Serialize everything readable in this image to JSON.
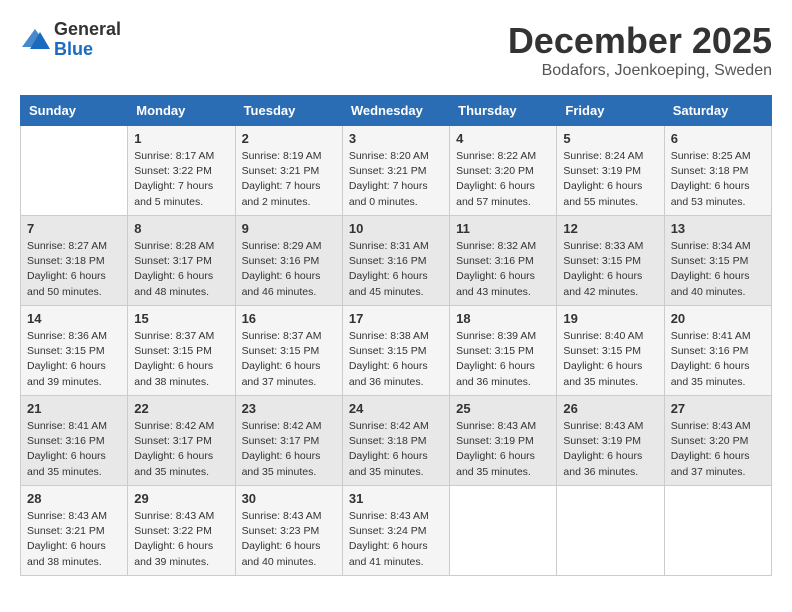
{
  "logo": {
    "general": "General",
    "blue": "Blue"
  },
  "title": "December 2025",
  "location": "Bodafors, Joenkoeping, Sweden",
  "days_header": [
    "Sunday",
    "Monday",
    "Tuesday",
    "Wednesday",
    "Thursday",
    "Friday",
    "Saturday"
  ],
  "weeks": [
    [
      {
        "day": "",
        "info": ""
      },
      {
        "day": "1",
        "info": "Sunrise: 8:17 AM\nSunset: 3:22 PM\nDaylight: 7 hours\nand 5 minutes."
      },
      {
        "day": "2",
        "info": "Sunrise: 8:19 AM\nSunset: 3:21 PM\nDaylight: 7 hours\nand 2 minutes."
      },
      {
        "day": "3",
        "info": "Sunrise: 8:20 AM\nSunset: 3:21 PM\nDaylight: 7 hours\nand 0 minutes."
      },
      {
        "day": "4",
        "info": "Sunrise: 8:22 AM\nSunset: 3:20 PM\nDaylight: 6 hours\nand 57 minutes."
      },
      {
        "day": "5",
        "info": "Sunrise: 8:24 AM\nSunset: 3:19 PM\nDaylight: 6 hours\nand 55 minutes."
      },
      {
        "day": "6",
        "info": "Sunrise: 8:25 AM\nSunset: 3:18 PM\nDaylight: 6 hours\nand 53 minutes."
      }
    ],
    [
      {
        "day": "7",
        "info": "Sunrise: 8:27 AM\nSunset: 3:18 PM\nDaylight: 6 hours\nand 50 minutes."
      },
      {
        "day": "8",
        "info": "Sunrise: 8:28 AM\nSunset: 3:17 PM\nDaylight: 6 hours\nand 48 minutes."
      },
      {
        "day": "9",
        "info": "Sunrise: 8:29 AM\nSunset: 3:16 PM\nDaylight: 6 hours\nand 46 minutes."
      },
      {
        "day": "10",
        "info": "Sunrise: 8:31 AM\nSunset: 3:16 PM\nDaylight: 6 hours\nand 45 minutes."
      },
      {
        "day": "11",
        "info": "Sunrise: 8:32 AM\nSunset: 3:16 PM\nDaylight: 6 hours\nand 43 minutes."
      },
      {
        "day": "12",
        "info": "Sunrise: 8:33 AM\nSunset: 3:15 PM\nDaylight: 6 hours\nand 42 minutes."
      },
      {
        "day": "13",
        "info": "Sunrise: 8:34 AM\nSunset: 3:15 PM\nDaylight: 6 hours\nand 40 minutes."
      }
    ],
    [
      {
        "day": "14",
        "info": "Sunrise: 8:36 AM\nSunset: 3:15 PM\nDaylight: 6 hours\nand 39 minutes."
      },
      {
        "day": "15",
        "info": "Sunrise: 8:37 AM\nSunset: 3:15 PM\nDaylight: 6 hours\nand 38 minutes."
      },
      {
        "day": "16",
        "info": "Sunrise: 8:37 AM\nSunset: 3:15 PM\nDaylight: 6 hours\nand 37 minutes."
      },
      {
        "day": "17",
        "info": "Sunrise: 8:38 AM\nSunset: 3:15 PM\nDaylight: 6 hours\nand 36 minutes."
      },
      {
        "day": "18",
        "info": "Sunrise: 8:39 AM\nSunset: 3:15 PM\nDaylight: 6 hours\nand 36 minutes."
      },
      {
        "day": "19",
        "info": "Sunrise: 8:40 AM\nSunset: 3:15 PM\nDaylight: 6 hours\nand 35 minutes."
      },
      {
        "day": "20",
        "info": "Sunrise: 8:41 AM\nSunset: 3:16 PM\nDaylight: 6 hours\nand 35 minutes."
      }
    ],
    [
      {
        "day": "21",
        "info": "Sunrise: 8:41 AM\nSunset: 3:16 PM\nDaylight: 6 hours\nand 35 minutes."
      },
      {
        "day": "22",
        "info": "Sunrise: 8:42 AM\nSunset: 3:17 PM\nDaylight: 6 hours\nand 35 minutes."
      },
      {
        "day": "23",
        "info": "Sunrise: 8:42 AM\nSunset: 3:17 PM\nDaylight: 6 hours\nand 35 minutes."
      },
      {
        "day": "24",
        "info": "Sunrise: 8:42 AM\nSunset: 3:18 PM\nDaylight: 6 hours\nand 35 minutes."
      },
      {
        "day": "25",
        "info": "Sunrise: 8:43 AM\nSunset: 3:19 PM\nDaylight: 6 hours\nand 35 minutes."
      },
      {
        "day": "26",
        "info": "Sunrise: 8:43 AM\nSunset: 3:19 PM\nDaylight: 6 hours\nand 36 minutes."
      },
      {
        "day": "27",
        "info": "Sunrise: 8:43 AM\nSunset: 3:20 PM\nDaylight: 6 hours\nand 37 minutes."
      }
    ],
    [
      {
        "day": "28",
        "info": "Sunrise: 8:43 AM\nSunset: 3:21 PM\nDaylight: 6 hours\nand 38 minutes."
      },
      {
        "day": "29",
        "info": "Sunrise: 8:43 AM\nSunset: 3:22 PM\nDaylight: 6 hours\nand 39 minutes."
      },
      {
        "day": "30",
        "info": "Sunrise: 8:43 AM\nSunset: 3:23 PM\nDaylight: 6 hours\nand 40 minutes."
      },
      {
        "day": "31",
        "info": "Sunrise: 8:43 AM\nSunset: 3:24 PM\nDaylight: 6 hours\nand 41 minutes."
      },
      {
        "day": "",
        "info": ""
      },
      {
        "day": "",
        "info": ""
      },
      {
        "day": "",
        "info": ""
      }
    ]
  ]
}
